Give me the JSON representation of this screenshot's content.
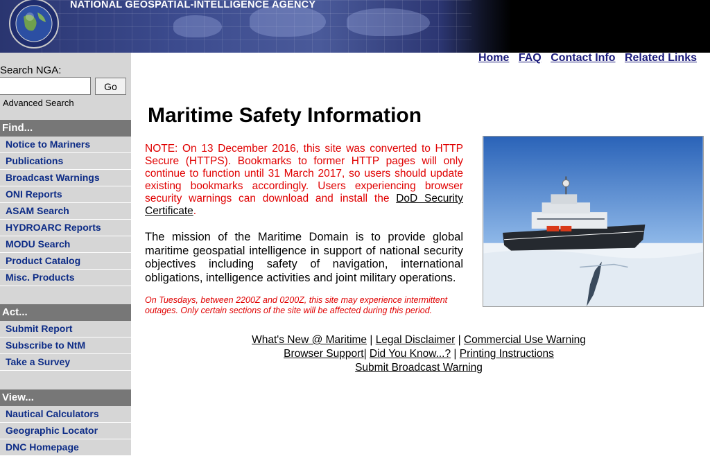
{
  "banner": {
    "agency_title": "NATIONAL GEOSPATIAL-INTELLIGENCE AGENCY"
  },
  "search": {
    "label": "Search NGA:",
    "go_label": "Go",
    "advanced_label": "Advanced Search",
    "value": ""
  },
  "sidebar": {
    "find": {
      "heading": "Find...",
      "items": [
        "Notice to Mariners",
        "Publications",
        "Broadcast Warnings",
        "ONI Reports",
        "ASAM Search",
        "HYDROARC Reports",
        "MODU Search",
        "Product Catalog",
        "Misc. Products"
      ]
    },
    "act": {
      "heading": "Act...",
      "items": [
        "Submit Report",
        "Subscribe to NtM",
        "Take a Survey"
      ]
    },
    "view": {
      "heading": "View...",
      "items": [
        "Nautical Calculators",
        "Geographic Locator",
        "DNC Homepage"
      ]
    }
  },
  "topnav": [
    "Home",
    "FAQ",
    "Contact Info",
    "Related Links"
  ],
  "main": {
    "title": "Maritime Safety Information",
    "note_text": "NOTE: On 13 December 2016, this site was converted to HTTP Secure (HTTPS). Bookmarks to former HTTP pages will only continue to function until 31 March 2017, so users should update existing bookmarks accordingly. Users experiencing browser security warnings can download and install the ",
    "note_link": "DoD Security Certificate",
    "note_end": ".",
    "mission": "The mission of the Maritime Domain is to provide global maritime geospatial intelligence in support of national security objectives including safety of navigation, international obligations, intelligence activities and joint military operations.",
    "outage": "On Tuesdays, between 2200Z and 0200Z, this site may experience intermittent outages. Only certain sections of the site will be affected during this period."
  },
  "footer": {
    "whats_new": "What's New @ Maritime",
    "disclaimer": "Legal Disclaimer",
    "commercial": "Commercial Use Warning",
    "browser": "Browser Support",
    "did_you_know": "Did You Know...?",
    "printing": "Printing Instructions",
    "submit_warning": "Submit Broadcast Warning",
    "sep": " | ",
    "sep_tight": "| "
  },
  "colors": {
    "nav_link": "#0c2b86",
    "note_red": "#e00000",
    "sidebar_bg": "#d6d6d6",
    "section_head": "#777777"
  }
}
